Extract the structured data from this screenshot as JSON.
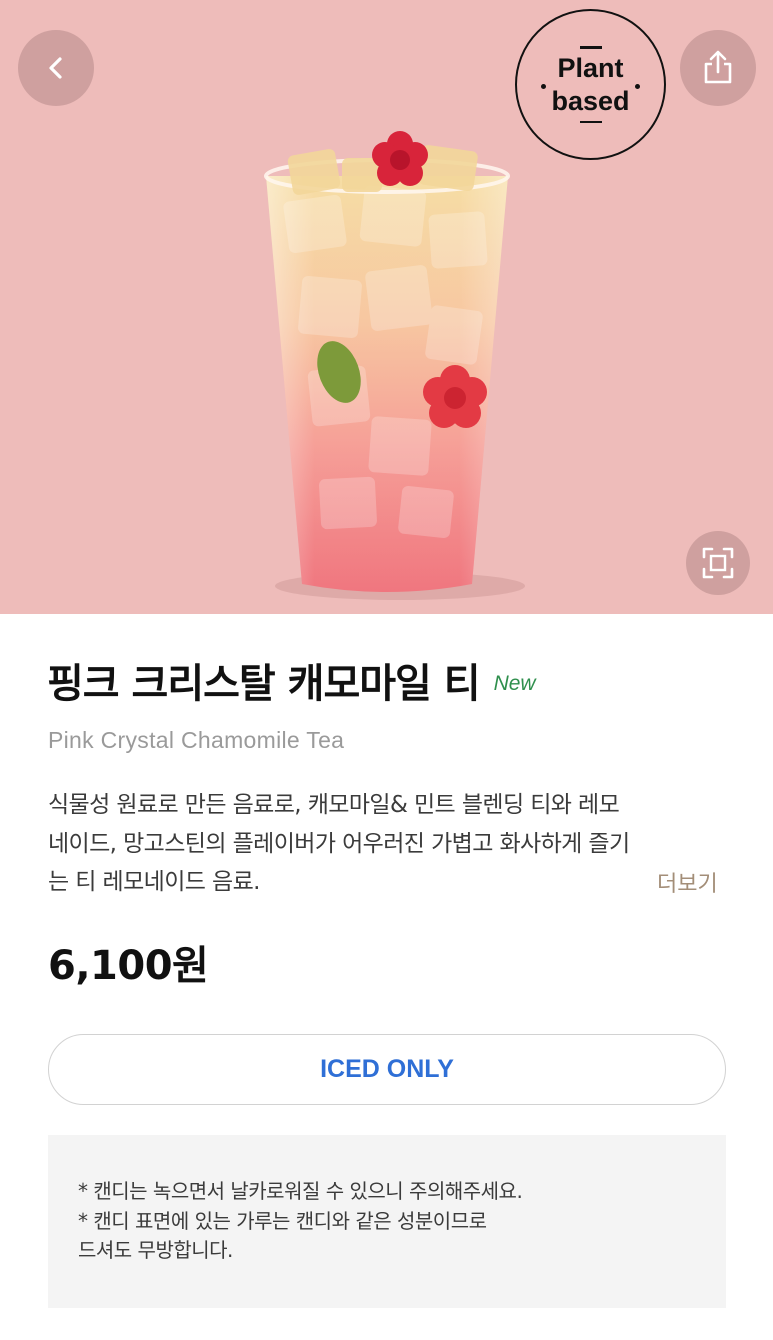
{
  "product": {
    "name_ko": "핑크 크리스탈 캐모마일 티",
    "new_label": "New",
    "name_en": "Pink Crystal Chamomile Tea",
    "description": [
      "식물성 원료로 만든 음료로, 캐모마일& 민트 블렌딩 티와 레모",
      "네이드, 망고스틴의 플레이버가 어우러진 가볍고 화사하게 즐기",
      "는 티 레모네이드 음료."
    ],
    "more_label": "더보기",
    "price": "6,100원",
    "option_label": "ICED ONLY"
  },
  "badge": {
    "line1": "Plant",
    "line2": "based"
  },
  "notice": [
    "* 캔디는 녹으면서 날카로워질 수 있으니 주의해주세요.",
    "* 캔디 표면에 있는 가루는 캔디와 같은 성분이므로",
    "드셔도 무방합니다."
  ],
  "icons": {
    "back": "chevron-left-icon",
    "share": "share-icon",
    "zoom": "expand-icon"
  },
  "colors": {
    "hero_background": "#eebcba",
    "new_tag": "#2f8f4d",
    "option_text": "#2f6fd6",
    "more_text": "#a38e78"
  }
}
